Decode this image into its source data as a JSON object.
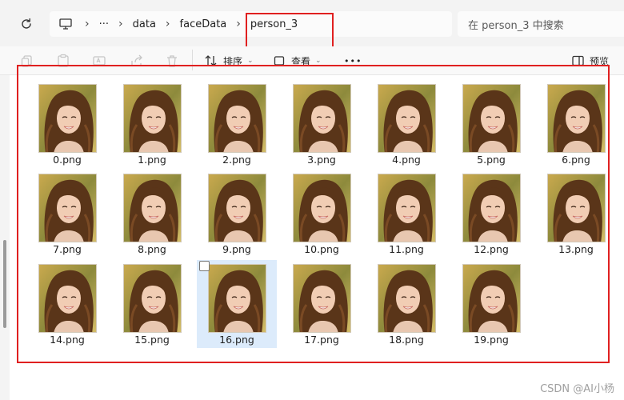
{
  "addressbar": {
    "crumbs": [
      "···",
      "data",
      "faceData",
      "person_3"
    ],
    "search_placeholder": "在 person_3 中搜索"
  },
  "toolbar": {
    "sort_label": "排序",
    "view_label": "查看",
    "more_label": "•••",
    "preview_label": "预览"
  },
  "files": [
    {
      "name": "0.png"
    },
    {
      "name": "1.png"
    },
    {
      "name": "2.png"
    },
    {
      "name": "3.png"
    },
    {
      "name": "4.png"
    },
    {
      "name": "5.png"
    },
    {
      "name": "6.png"
    },
    {
      "name": "7.png"
    },
    {
      "name": "8.png"
    },
    {
      "name": "9.png"
    },
    {
      "name": "10.png"
    },
    {
      "name": "11.png"
    },
    {
      "name": "12.png"
    },
    {
      "name": "13.png"
    },
    {
      "name": "14.png"
    },
    {
      "name": "15.png"
    },
    {
      "name": "16.png",
      "selected": true
    },
    {
      "name": "17.png"
    },
    {
      "name": "18.png"
    },
    {
      "name": "19.png"
    }
  ],
  "watermark": "CSDN @AI小杨",
  "colors": {
    "highlight_frame": "#e02020",
    "selection": "#dcebfb"
  }
}
